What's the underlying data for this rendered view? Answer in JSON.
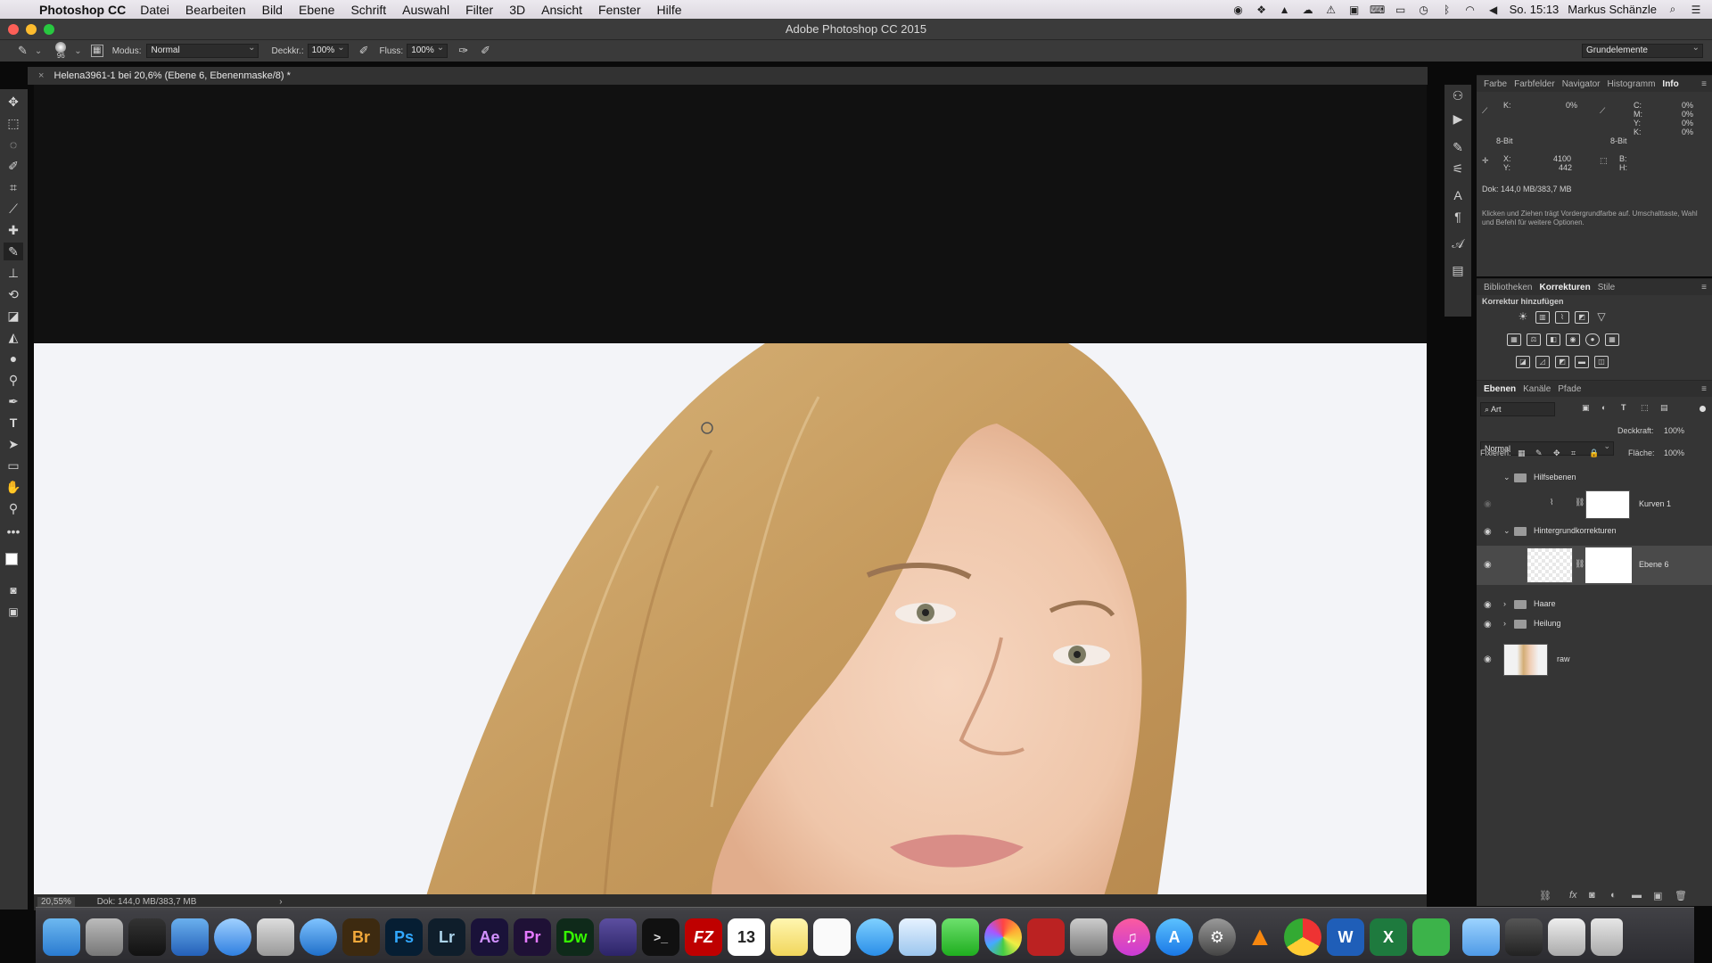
{
  "menubar": {
    "app": "Photoshop CC",
    "items": [
      "Datei",
      "Bearbeiten",
      "Bild",
      "Ebene",
      "Schrift",
      "Auswahl",
      "Filter",
      "3D",
      "Ansicht",
      "Fenster",
      "Hilfe"
    ],
    "clock": "So. 15:13",
    "user": "Markus Schänzle"
  },
  "window": {
    "title": "Adobe Photoshop CC 2015"
  },
  "options": {
    "brush_size": "96",
    "modus_label": "Modus:",
    "modus_value": "Normal",
    "deckkr_label": "Deckkr.:",
    "deckkr_value": "100%",
    "fluss_label": "Fluss:",
    "fluss_value": "100%",
    "workspace": "Grundelemente"
  },
  "document": {
    "tab": "Helena3961-1 bei 20,6% (Ebene 6, Ebenenmaske/8) *",
    "zoom": "20,55%",
    "doc_size": "Dok: 144,0 MB/383,7 MB"
  },
  "info_panel": {
    "tabs": [
      "Farbe",
      "Farbfelder",
      "Navigator",
      "Histogramm",
      "Info"
    ],
    "active_tab": "Info",
    "k_label": "K:",
    "k_value": "0%",
    "cmyk_labels": "C:\nM:\nY:\nK:",
    "cmyk_values": "0%\n0%\n0%\n0%",
    "bit_left": "8-Bit",
    "bit_right": "8-Bit",
    "x_label": "X:",
    "y_label": "Y:",
    "x_value": "4100",
    "y_value": "442",
    "b_label": "B:",
    "h_label": "H:",
    "doc": "Dok: 144,0 MB/383,7 MB",
    "hint": "Klicken und Ziehen trägt Vordergrundfarbe auf. Umschalttaste, Wahl und Befehl für weitere Optionen."
  },
  "adjust_panel": {
    "tabs": [
      "Bibliotheken",
      "Korrekturen",
      "Stile"
    ],
    "active_tab": "Korrekturen",
    "title": "Korrektur hinzufügen"
  },
  "layers_panel": {
    "tabs": [
      "Ebenen",
      "Kanäle",
      "Pfade"
    ],
    "active_tab": "Ebenen",
    "filter": "Art",
    "blend": "Normal",
    "opacity_label": "Deckkraft:",
    "opacity": "100%",
    "lock_label": "Fixieren:",
    "fill_label": "Fläche:",
    "fill": "100%",
    "layers": [
      {
        "name": "Hilfsebenen",
        "type": "group"
      },
      {
        "name": "Kurven 1",
        "type": "adjustment"
      },
      {
        "name": "Hintergrundkorrekturen",
        "type": "group"
      },
      {
        "name": "Ebene 6",
        "type": "layer"
      },
      {
        "name": "Haare",
        "type": "group"
      },
      {
        "name": "Heilung",
        "type": "group"
      },
      {
        "name": "raw",
        "type": "image"
      }
    ]
  },
  "dock": {
    "apps": [
      "Finder",
      "Launchpad",
      "Mission Control",
      "Xcode",
      "Safari",
      "Preview",
      "1Password",
      "Br",
      "Ps",
      "Lr",
      "Ae",
      "Pr",
      "Dw",
      "iMovie",
      "Terminal",
      "FileZilla",
      "13",
      "Notes",
      "Reminders",
      "Messages",
      "Mail",
      "FaceTime",
      "Photos",
      "Photo Booth",
      "Dictionary",
      "iTunes",
      "App Store",
      "System Preferences",
      "VLC",
      "Chrome",
      "W",
      "X",
      "Evernote",
      "Folder",
      "Brushes",
      "Downloads",
      "Trash"
    ]
  }
}
